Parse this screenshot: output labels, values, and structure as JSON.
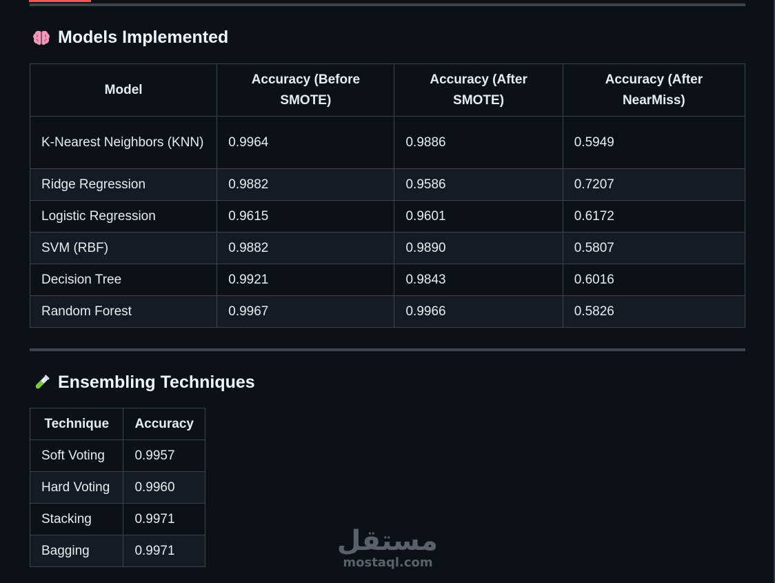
{
  "models_section": {
    "title": "Models Implemented",
    "icon": "brain-icon",
    "columns": [
      "Model",
      "Accuracy (Before SMOTE)",
      "Accuracy (After SMOTE)",
      "Accuracy (After NearMiss)"
    ],
    "rows": [
      [
        "K-Nearest Neighbors (KNN)",
        "0.9964",
        "0.9886",
        "0.5949"
      ],
      [
        "Ridge Regression",
        "0.9882",
        "0.9586",
        "0.7207"
      ],
      [
        "Logistic Regression",
        "0.9615",
        "0.9601",
        "0.6172"
      ],
      [
        "SVM (RBF)",
        "0.9882",
        "0.9890",
        "0.5807"
      ],
      [
        "Decision Tree",
        "0.9921",
        "0.9843",
        "0.6016"
      ],
      [
        "Random Forest",
        "0.9967",
        "0.9966",
        "0.5826"
      ]
    ]
  },
  "ensemble_section": {
    "title": "Ensembling Techniques",
    "icon": "test-tube-icon",
    "columns": [
      "Technique",
      "Accuracy"
    ],
    "rows": [
      [
        "Soft Voting",
        "0.9957"
      ],
      [
        "Hard Voting",
        "0.9960"
      ],
      [
        "Stacking",
        "0.9971"
      ],
      [
        "Bagging",
        "0.9971"
      ]
    ]
  },
  "watermark": {
    "arabic": "مستقل",
    "latin": "mostaql.com"
  },
  "colors": {
    "background": "#0d1117",
    "row_alt": "#151b23",
    "border": "#3d444d",
    "accent": "#f0574c"
  }
}
